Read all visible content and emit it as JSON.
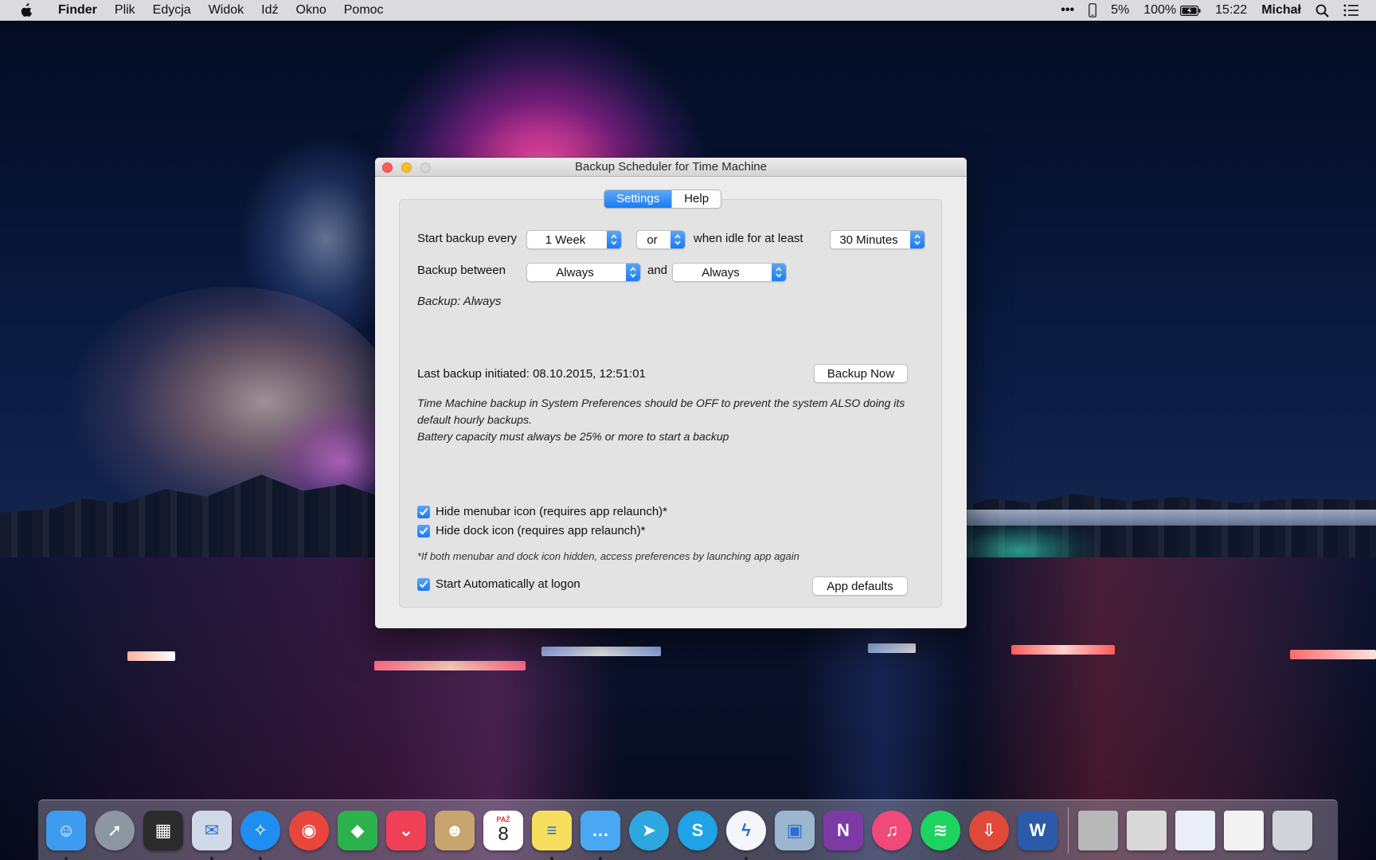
{
  "menubar": {
    "app_name": "Finder",
    "items": [
      "Plik",
      "Edycja",
      "Widok",
      "Idź",
      "Okno",
      "Pomoc"
    ],
    "status": {
      "more": "•••",
      "percent_small": "5%",
      "battery": "100%",
      "time": "15:22",
      "user": "Michał"
    }
  },
  "window": {
    "title": "Backup Scheduler for Time Machine",
    "tabs": [
      {
        "label": "Settings",
        "active": true
      },
      {
        "label": "Help",
        "active": false
      }
    ],
    "start_backup_label": "Start backup every",
    "interval_value": "1 Week",
    "or_value": "or",
    "idle_label": "when idle for at least",
    "idle_value": "30 Minutes",
    "between_label": "Backup between",
    "between_from": "Always",
    "and_label": "and",
    "between_to": "Always",
    "summary": "Backup: Always",
    "last_backup": "Last backup initiated: 08.10.2015, 12:51:01",
    "backup_now": "Backup Now",
    "note_line1": "Time Machine backup in System Preferences should be OFF to prevent the system ALSO doing its",
    "note_line2": "default hourly backups.",
    "note_line3": "Battery capacity must always be 25% or more to start a backup",
    "hide_menubar": {
      "label": "Hide menubar icon (requires app relaunch)*",
      "checked": true
    },
    "hide_dock": {
      "label": "Hide dock icon (requires app relaunch)*",
      "checked": true
    },
    "footnote": "*If both menubar and dock icon hidden, access preferences by launching app again",
    "start_auto": {
      "label": "Start Automatically at logon",
      "checked": true
    },
    "app_defaults": "App defaults"
  },
  "dock": {
    "calendar_month": "PAŹ",
    "calendar_day": "8",
    "apps": [
      {
        "name": "finder-icon",
        "color": "#3d9bf0",
        "glyph": "☺",
        "running": true
      },
      {
        "name": "launchpad-icon",
        "color": "#8d96a3",
        "glyph": "➚",
        "running": false
      },
      {
        "name": "photo-viewer-icon",
        "color": "#2b2b2b",
        "glyph": "▦",
        "running": false
      },
      {
        "name": "mail-stamp-icon",
        "color": "#cfd9e8",
        "glyph": "✉",
        "running": true
      },
      {
        "name": "safari-icon",
        "color": "#1f8ef0",
        "glyph": "✧",
        "running": true
      },
      {
        "name": "chrome-icon",
        "color": "#e8463b",
        "glyph": "◉",
        "running": false
      },
      {
        "name": "feedly-icon",
        "color": "#2bb24c",
        "glyph": "◆",
        "running": false
      },
      {
        "name": "pocket-icon",
        "color": "#ef4056",
        "glyph": "⌄",
        "running": false
      },
      {
        "name": "contacts-icon",
        "color": "#c8a46e",
        "glyph": "☻",
        "running": false
      },
      {
        "name": "calendar-icon",
        "color": "#ffffff",
        "glyph": "",
        "running": false
      },
      {
        "name": "notes-icon",
        "color": "#f6df5d",
        "glyph": "≡",
        "running": true
      },
      {
        "name": "messages-icon",
        "color": "#4aa7f4",
        "glyph": "…",
        "running": true
      },
      {
        "name": "telegram-icon",
        "color": "#2ea6e0",
        "glyph": "➤",
        "running": false
      },
      {
        "name": "skype-icon",
        "color": "#1fa3e6",
        "glyph": "S",
        "running": false
      },
      {
        "name": "messenger-icon",
        "color": "#f4f6fb",
        "glyph": "ϟ",
        "running": true
      },
      {
        "name": "preview-icon",
        "color": "#9cb6cf",
        "glyph": "▣",
        "running": false
      },
      {
        "name": "onenote-icon",
        "color": "#7d3aa5",
        "glyph": "N",
        "running": false
      },
      {
        "name": "itunes-icon",
        "color": "#f04b78",
        "glyph": "♫",
        "running": false
      },
      {
        "name": "spotify-icon",
        "color": "#1ed35f",
        "glyph": "≋",
        "running": false
      },
      {
        "name": "transmit-icon",
        "color": "#e04838",
        "glyph": "⇩",
        "running": false
      },
      {
        "name": "word-icon",
        "color": "#2b5aa8",
        "glyph": "W",
        "running": false
      }
    ],
    "stacks": [
      {
        "name": "folder-stack-icon",
        "color": "#b8b8b8"
      },
      {
        "name": "downloads-stack-icon",
        "color": "#d9d9d9"
      },
      {
        "name": "documents-stack-icon",
        "color": "#e9eef7"
      },
      {
        "name": "notes-stack-icon",
        "color": "#f3f3f3"
      },
      {
        "name": "trash-icon",
        "color": "#d0d4da"
      }
    ]
  }
}
